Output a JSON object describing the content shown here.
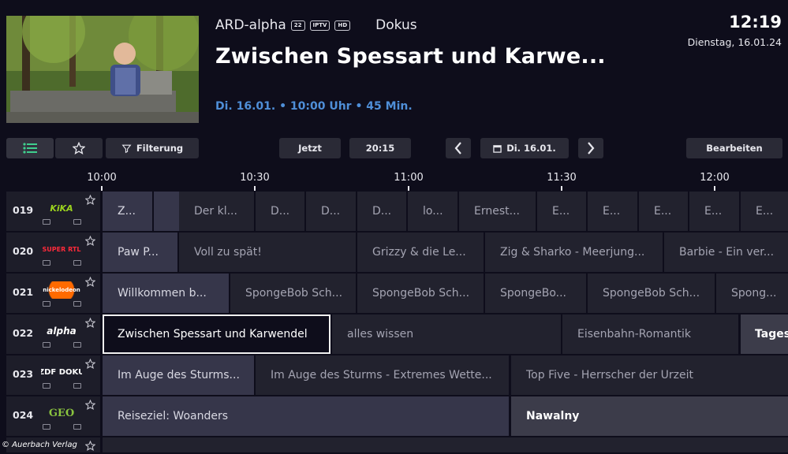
{
  "header": {
    "channel_name": "ARD-alpha",
    "badges": [
      "22",
      "IPTV",
      "HD"
    ],
    "genre": "Dokus",
    "title": "Zwischen Spessart und Karwe...",
    "airtime": "Di. 16.01. • 10:00 Uhr • 45 Min.",
    "clock": "12:19",
    "date": "Dienstag, 16.01.24"
  },
  "toolbar": {
    "list_icon": "list-icon",
    "favorites_icon": "star-icon",
    "filter_label": "Filterung",
    "now_label": "Jetzt",
    "time_2015_label": "20:15",
    "date_label": "Di. 16.01.",
    "edit_label": "Bearbeiten"
  },
  "timeline": {
    "labels": [
      "10:00",
      "10:30",
      "11:00",
      "11:30",
      "12:00"
    ]
  },
  "channels": [
    {
      "number": "019",
      "logo": "KiKA",
      "programs": [
        "Z...",
        "",
        "",
        "Der kl...",
        "D...",
        "D...",
        "D...",
        "lo...",
        "Ernest...",
        "E...",
        "E...",
        "E...",
        "E...",
        "E..."
      ]
    },
    {
      "number": "020",
      "logo": "SUPER RTL",
      "programs": [
        "Paw P...",
        "Voll zu spät!",
        "Grizzy & die Le...",
        "Zig & Sharko - Meerjung...",
        "Barbie - Ein ver..."
      ]
    },
    {
      "number": "021",
      "logo": "nickelodeon",
      "programs": [
        "Willkommen b...",
        "SpongeBob Sch...",
        "SpongeBob Sch...",
        "SpongeBo...",
        "SpongeBob Sch...",
        "Spong..."
      ]
    },
    {
      "number": "022",
      "logo": "alpha",
      "programs": [
        "Zwischen Spessart und Karwendel",
        "alles wissen",
        "Eisenbahn-Romantik",
        "Tages"
      ]
    },
    {
      "number": "023",
      "logo": "ZDF DOKU",
      "programs": [
        "Im Auge des Sturms...",
        "Im Auge des Sturms - Extremes Wette...",
        "Top Five - Herrscher der Urzeit"
      ]
    },
    {
      "number": "024",
      "logo": "GEO",
      "programs": [
        "Reiseziel: Woanders",
        "Nawalny"
      ]
    }
  ],
  "copyright": "© Auerbach Verlag",
  "colors": {
    "background": "#0e0d1b",
    "cell": "#22222e",
    "accent_time": "#4f8fd8",
    "selected_border": "#f0f0f0"
  }
}
